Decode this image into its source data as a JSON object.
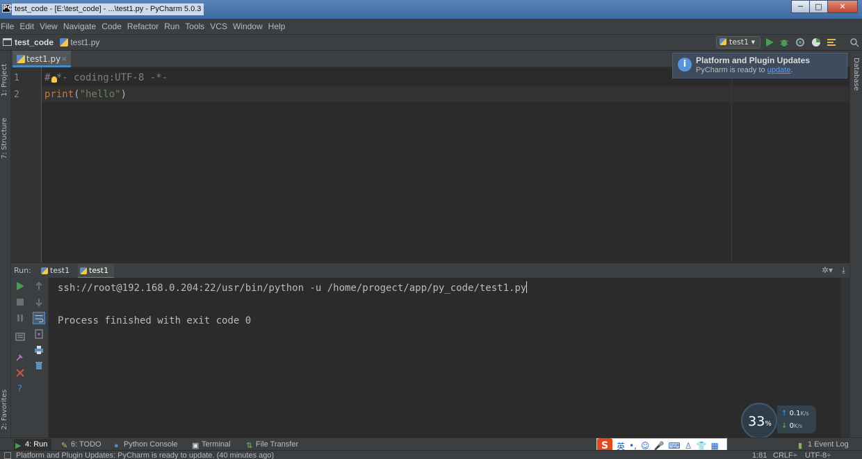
{
  "window": {
    "title": "test_code - [E:\\test_code] - ...\\test1.py - PyCharm 5.0.3",
    "app_icon_label": "PC",
    "controls": {
      "minimize": "─",
      "maximize": "□",
      "close": "✕"
    }
  },
  "menu": {
    "items": [
      "File",
      "Edit",
      "View",
      "Navigate",
      "Code",
      "Refactor",
      "Run",
      "Tools",
      "VCS",
      "Window",
      "Help"
    ]
  },
  "navbar": {
    "project": "test_code",
    "file": "test1.py",
    "run_config": "test1",
    "run_config_arrow": "▾"
  },
  "editor": {
    "tab": {
      "label": "test1.py",
      "close": "×"
    },
    "lines": [
      {
        "number": "1",
        "text": "#-*- coding:UTF-8 -*-"
      },
      {
        "number": "2",
        "keyword": "print",
        "open": "(",
        "string": "\"hello\"",
        "close": ")"
      }
    ]
  },
  "notification": {
    "icon": "i",
    "title": "Platform and Plugin Updates",
    "message_prefix": "PyCharm is ready to ",
    "link": "update",
    "message_suffix": "."
  },
  "side_stripes": {
    "left_top": [
      "1: Project",
      "7: Structure"
    ],
    "left_bottom": [
      "2: Favorites"
    ],
    "right": [
      "Database"
    ]
  },
  "run_panel": {
    "label": "Run:",
    "tabs": [
      {
        "label": "test1",
        "active": false
      },
      {
        "label": "test1",
        "active": true
      }
    ],
    "settings_glyph": "✲▾",
    "hide_glyph": "⤓",
    "console_lines": [
      "ssh://root@192.168.0.204:22/usr/bin/python -u /home/progect/app/py_code/test1.py",
      "Process finished with exit code 0"
    ]
  },
  "net_speed": {
    "percent": "33",
    "percent_unit": "%",
    "up": "0.1",
    "down": "0",
    "unit": "K/s"
  },
  "bottom_tabs": [
    {
      "label": "4: Run",
      "active": true
    },
    {
      "label": "6: TODO",
      "active": false
    },
    {
      "label": "Python Console",
      "active": false
    },
    {
      "label": "Terminal",
      "active": false
    },
    {
      "label": "File Transfer",
      "active": false
    }
  ],
  "ime": {
    "logo": "S",
    "mode": "英"
  },
  "event_log": "1 Event Log",
  "status": {
    "message": "Platform and Plugin Updates: PyCharm is ready to update. (40 minutes ago)",
    "position": "1:81",
    "line_sep": "CRLF÷",
    "encoding": "UTF-8÷"
  },
  "colors": {
    "accent": "#4a88c7",
    "run_green": "#499c54",
    "string": "#6a8759",
    "comment": "#808080",
    "keyword": "#cc7832",
    "stop_red": "#c75450"
  }
}
